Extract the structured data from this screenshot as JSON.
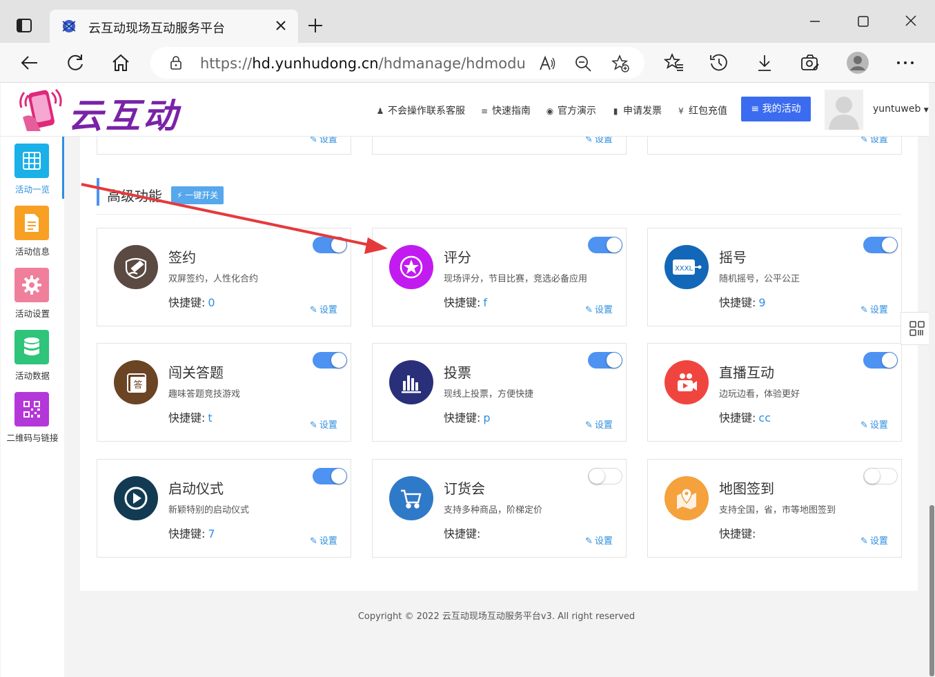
{
  "browser": {
    "tab_title": "云互动现场互动服务平台",
    "url_prefix": "https://",
    "url_domain": "hd.yunhudong.cn",
    "url_rest": "/hdmanage/hdmodule/i..."
  },
  "header": {
    "logo_text": "云互动",
    "nav": [
      {
        "label": "不会操作联系客服",
        "icon": "user-icon"
      },
      {
        "label": "快速指南",
        "icon": "list-icon"
      },
      {
        "label": "官方演示",
        "icon": "play-circle-icon"
      },
      {
        "label": "申请发票",
        "icon": "barcode-icon"
      },
      {
        "label": "红包充值",
        "icon": "yen-icon"
      }
    ],
    "my_activity": "我的活动",
    "username": "yuntuweb"
  },
  "sidebar": {
    "items": [
      {
        "label": "活动一览",
        "icon": "grid-icon",
        "color": "#1ab0e8"
      },
      {
        "label": "活动信息",
        "icon": "document-icon",
        "color": "#f7a023"
      },
      {
        "label": "活动设置",
        "icon": "gear-icon",
        "color": "#f07f9c"
      },
      {
        "label": "活动数据",
        "icon": "database-icon",
        "color": "#2ec47a"
      },
      {
        "label": "二维码与链接",
        "icon": "qrcode-icon",
        "color": "#b437d9"
      }
    ]
  },
  "top_row": {
    "setting_label": "设置"
  },
  "section": {
    "title": "高级功能",
    "one_key_label": "一键开关"
  },
  "shortcut_label": "快捷键:",
  "setting_label": "设置",
  "cards": [
    {
      "title": "签约",
      "desc": "双屏签约，人性化合约",
      "key": "0",
      "enabled": true,
      "icon": "signature-icon",
      "color": "#5a4a42"
    },
    {
      "title": "评分",
      "desc": "现场评分，节目比赛，竞选必备应用",
      "key": "f",
      "enabled": true,
      "icon": "star-icon",
      "color": "#c21bf0"
    },
    {
      "title": "摇号",
      "desc": "随机摇号，公平公正",
      "key": "9",
      "enabled": true,
      "icon": "lottery-icon",
      "color": "#1367b8"
    },
    {
      "title": "闯关答题",
      "desc": "趣味答题竞技游戏",
      "key": "t",
      "enabled": true,
      "icon": "quiz-icon",
      "color": "#6b4424"
    },
    {
      "title": "投票",
      "desc": "现线上投票，方便快捷",
      "key": "p",
      "enabled": true,
      "icon": "bar-chart-icon",
      "color": "#2a2f7a"
    },
    {
      "title": "直播互动",
      "desc": "边玩边看，体验更好",
      "key": "cc",
      "enabled": true,
      "icon": "video-camera-icon",
      "color": "#f0453f"
    },
    {
      "title": "启动仪式",
      "desc": "新颖特别的启动仪式",
      "key": "7",
      "enabled": true,
      "icon": "play-icon",
      "color": "#123a52"
    },
    {
      "title": "订货会",
      "desc": "支持多种商品，阶梯定价",
      "key": "",
      "enabled": false,
      "icon": "cart-icon",
      "color": "#2f79c9"
    },
    {
      "title": "地图签到",
      "desc": "支持全国，省，市等地图签到",
      "key": "",
      "enabled": false,
      "icon": "map-pin-icon",
      "color": "#f5a13c"
    }
  ],
  "footer": "Copyright © 2022 云互动现场互动服务平台v3. All right reserved"
}
